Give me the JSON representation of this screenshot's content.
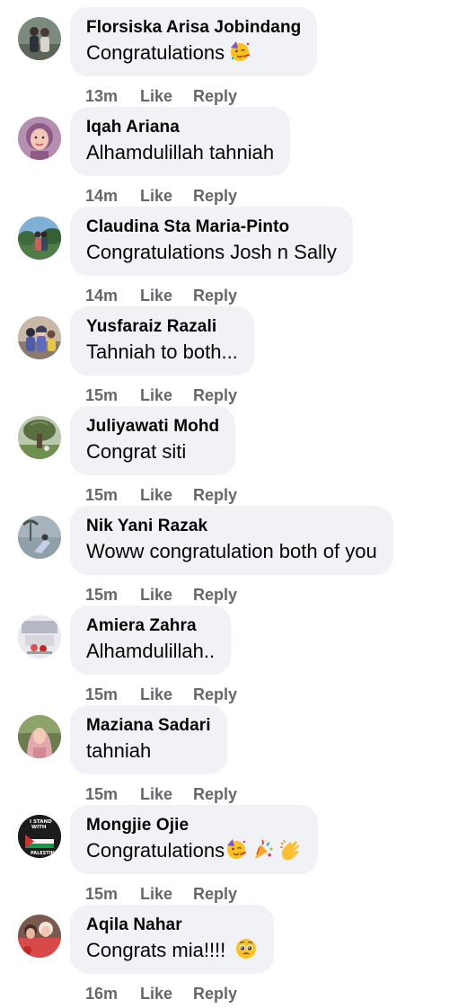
{
  "comments": [
    {
      "author": "Florsiska Arisa Jobindang",
      "text": "Congratulations",
      "emojis": [
        "partying-face"
      ],
      "time": "13m",
      "like": "Like",
      "reply": "Reply",
      "avatar": "avatar-photo-couple"
    },
    {
      "author": "Iqah Ariana",
      "text": "Alhamdulillah tahniah",
      "emojis": [],
      "time": "14m",
      "like": "Like",
      "reply": "Reply",
      "avatar": "avatar-photo-woman-hijab"
    },
    {
      "author": "Claudina Sta Maria-Pinto",
      "text": "Congratulations Josh n Sally",
      "emojis": [],
      "time": "14m",
      "like": "Like",
      "reply": "Reply",
      "avatar": "avatar-photo-outdoor"
    },
    {
      "author": "Yusfaraiz Razali",
      "text": "Tahniah to both...",
      "emojis": [],
      "time": "15m",
      "like": "Like",
      "reply": "Reply",
      "avatar": "avatar-photo-group"
    },
    {
      "author": "Juliyawati Mohd",
      "text": "Congrat siti",
      "emojis": [],
      "time": "15m",
      "like": "Like",
      "reply": "Reply",
      "avatar": "avatar-photo-tree"
    },
    {
      "author": "Nik Yani Razak",
      "text": "Woww congratulation both of you",
      "emojis": [],
      "time": "15m",
      "like": "Like",
      "reply": "Reply",
      "avatar": "avatar-photo-beach"
    },
    {
      "author": "Amiera Zahra",
      "text": "Alhamdulillah..",
      "emojis": [],
      "time": "15m",
      "like": "Like",
      "reply": "Reply",
      "avatar": "avatar-photo-indoor"
    },
    {
      "author": "Maziana Sadari",
      "text": "tahniah",
      "emojis": [],
      "time": "15m",
      "like": "Like",
      "reply": "Reply",
      "avatar": "avatar-photo-woman-pink-hijab"
    },
    {
      "author": "Mongjie Ojie",
      "text": "Congratulations",
      "emojis": [
        "partying-face",
        "party-popper",
        "clapping-hands"
      ],
      "time": "15m",
      "like": "Like",
      "reply": "Reply",
      "avatar": "avatar-i-stand-with-palestine"
    },
    {
      "author": "Aqila Nahar",
      "text": "Congrats mia!!!! ",
      "emojis": [
        "pleading-face"
      ],
      "time": "16m",
      "like": "Like",
      "reply": "Reply",
      "avatar": "avatar-photo-family"
    }
  ],
  "avatar_text": {
    "palestine_line1": "I STAND",
    "palestine_line2": "WITH",
    "palestine_line3": "PALESTINE"
  },
  "colors": {
    "bubble_bg": "#f0f2f5",
    "text": "#050505",
    "meta": "#65676b"
  }
}
